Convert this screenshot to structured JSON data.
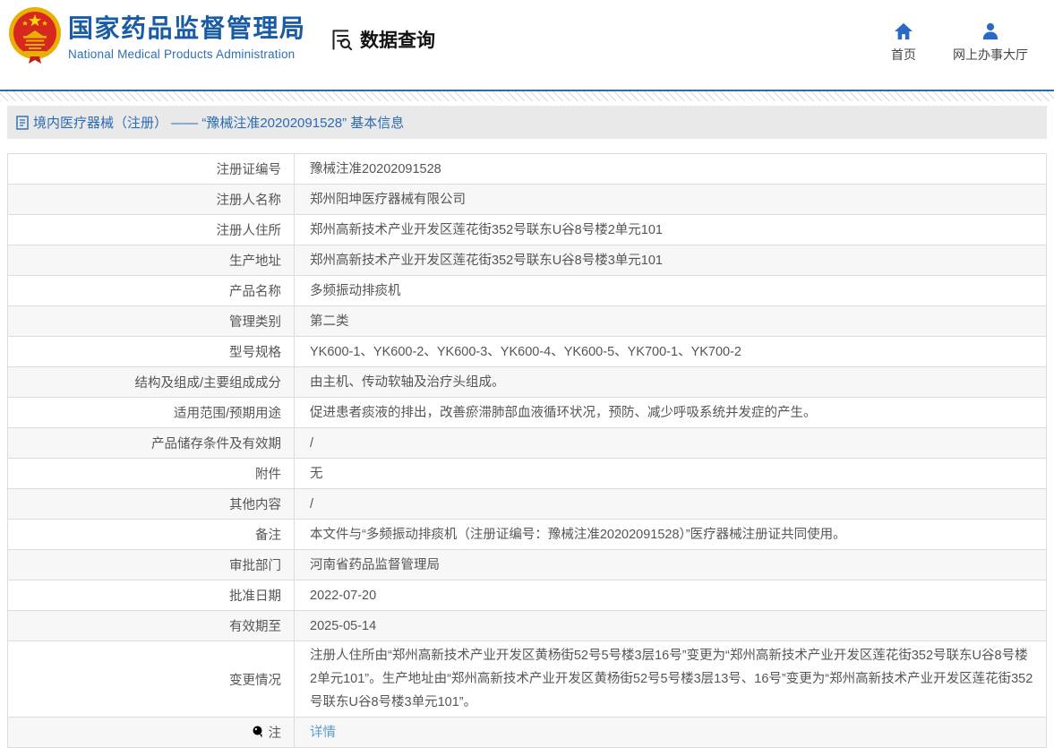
{
  "header": {
    "brand": {
      "title": "国家药品监督管理局",
      "subtitle": "National Medical Products Administration"
    },
    "nav": {
      "data_query": "数据查询"
    },
    "quick_links": {
      "home": "首页",
      "hall": "网上办事大厅"
    }
  },
  "section": {
    "title": "境内医疗器械（注册） —— “豫械注准20202091528” 基本信息"
  },
  "table": {
    "rows": [
      {
        "label": "注册证编号",
        "value": "豫械注准20202091528"
      },
      {
        "label": "注册人名称",
        "value": "郑州阳坤医疗器械有限公司"
      },
      {
        "label": "注册人住所",
        "value": "郑州高新技术产业开发区莲花街352号联东U谷8号楼2单元101"
      },
      {
        "label": "生产地址",
        "value": "郑州高新技术产业开发区莲花街352号联东U谷8号楼3单元101"
      },
      {
        "label": "产品名称",
        "value": "多频振动排痰机"
      },
      {
        "label": "管理类别",
        "value": "第二类"
      },
      {
        "label": "型号规格",
        "value": "YK600-1、YK600-2、YK600-3、YK600-4、YK600-5、YK700-1、YK700-2"
      },
      {
        "label": "结构及组成/主要组成成分",
        "value": "由主机、传动软轴及治疗头组成。"
      },
      {
        "label": "适用范围/预期用途",
        "value": "促进患者痰液的排出，改善瘀滞肺部血液循环状况，预防、减少呼吸系统并发症的产生。"
      },
      {
        "label": "产品储存条件及有效期",
        "value": "/"
      },
      {
        "label": "附件",
        "value": "无"
      },
      {
        "label": "其他内容",
        "value": "/"
      },
      {
        "label": "备注",
        "value": "本文件与“多频振动排痰机（注册证编号：豫械注准20202091528）”医疗器械注册证共同使用。"
      },
      {
        "label": "审批部门",
        "value": "河南省药品监督管理局"
      },
      {
        "label": "批准日期",
        "value": "2022-07-20"
      },
      {
        "label": "有效期至",
        "value": "2025-05-14"
      },
      {
        "label": "变更情况",
        "value": "注册人住所由“郑州高新技术产业开发区黄杨街52号5号楼3层16号”变更为“郑州高新技术产业开发区莲花街352号联东U谷8号楼2单元101”。生产地址由“郑州高新技术产业开发区黄杨街52号5号楼3层13号、16号”变更为“郑州高新技术产业开发区莲花街352号联东U谷8号楼3单元101”。"
      }
    ],
    "note_row": {
      "label": "注",
      "link_label": "详情"
    }
  },
  "colors": {
    "brand_blue": "#1a5ba6",
    "icon_blue": "#2a6ac6",
    "section_blue": "#2b6bb3",
    "top_line": "#2e6da4",
    "link_blue": "#5b9bd5",
    "alt_row_bg": "#f7f7f7",
    "section_bar_bg": "#e9e9e9",
    "border": "#dcdcdc",
    "emblem_red": "#d6281e",
    "emblem_gold": "#e8b004"
  }
}
